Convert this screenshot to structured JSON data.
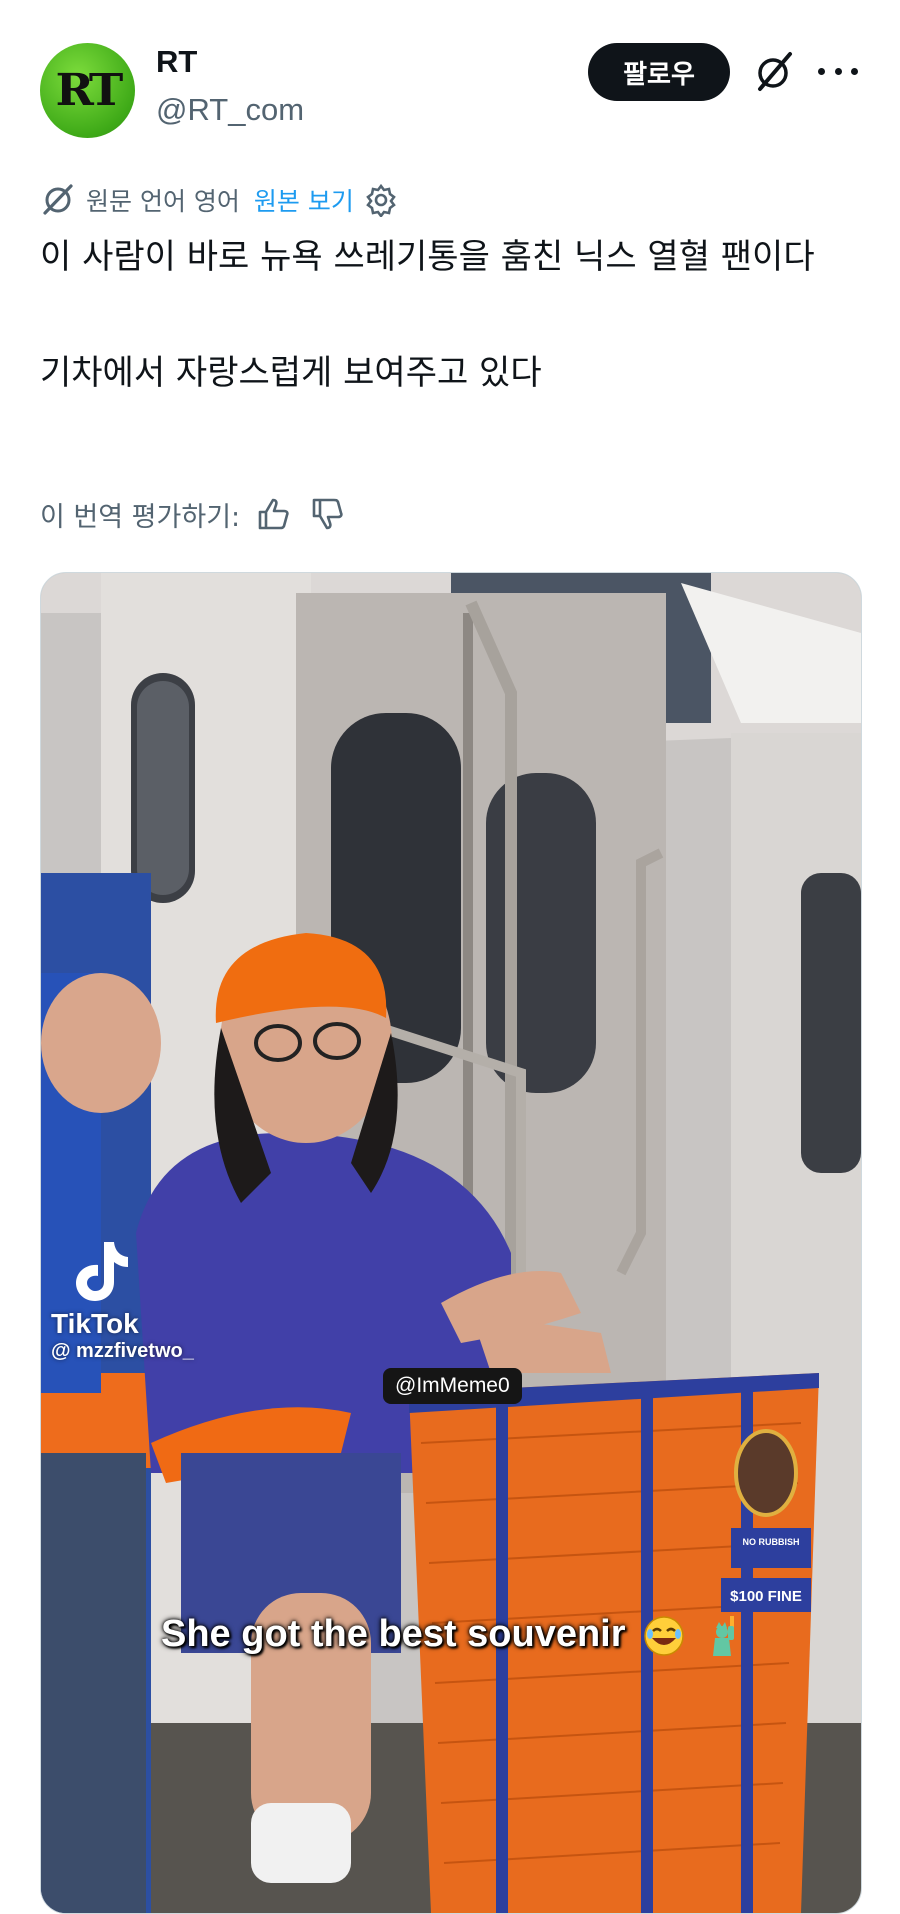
{
  "account": {
    "avatar_text": "RT",
    "name": "RT",
    "handle": "@RT_com",
    "follow_label": "팔로우"
  },
  "translation": {
    "language_note": "원문 언어 영어",
    "view_original": "원본 보기"
  },
  "tweet": {
    "text": "이 사람이 바로 뉴욕 쓰레기통을 훔친 닉스 열혈 팬이다\n\n기차에서 자랑스럽게 보여주고 있다"
  },
  "rating": {
    "label": "이 번역 평가하기:"
  },
  "media": {
    "watermark_brand": "TikTok",
    "watermark_user": "@ mzzfivetwo_",
    "tag": "@ImMeme0",
    "caption": "She got the best souvenir",
    "trash_can_sign_1": "NO RUBBISH",
    "trash_can_sign_2": "$100 FINE"
  },
  "colors": {
    "accent_link": "#1d9bf0",
    "follow_bg": "#0f1419",
    "muted_text": "#536471",
    "avatar_green": "#5cc22a",
    "jersey_blue": "#2447b8",
    "jersey_orange": "#f06a14"
  },
  "icons": [
    "grok-icon",
    "more-icon",
    "translate-icon",
    "gear-icon",
    "thumbs-up-icon",
    "thumbs-down-icon",
    "tiktok-icon",
    "laughing-emoji-icon",
    "statue-of-liberty-icon"
  ]
}
